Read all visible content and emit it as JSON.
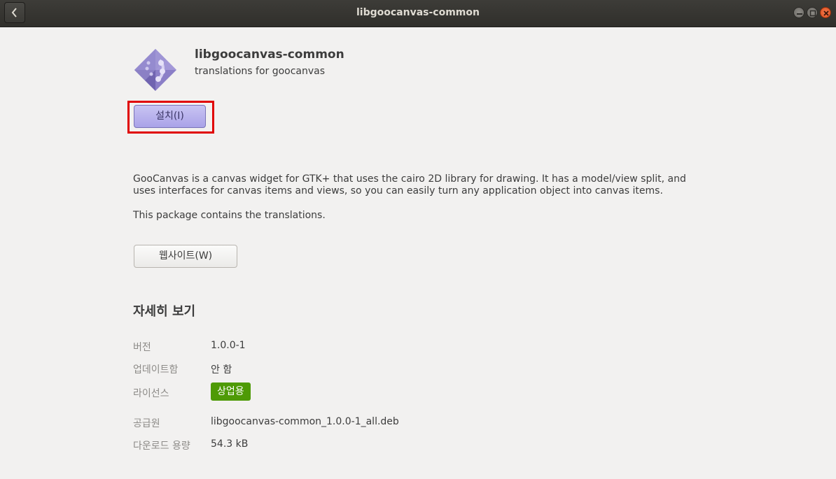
{
  "window": {
    "title": "libgoocanvas-common",
    "back_icon": "chevron-left-icon",
    "controls": [
      "minimize-icon",
      "maximize-icon",
      "close-icon"
    ],
    "close_color": "#e95420"
  },
  "app": {
    "name": "libgoocanvas-common",
    "summary": "translations for goocanvas",
    "icon": "package-icon",
    "icon_color": "#8b7fc7"
  },
  "actions": {
    "install_label": "설치(I)",
    "install_color": "#b3acec",
    "website_label": "웹사이트(W)"
  },
  "description": {
    "paragraphs": [
      "GooCanvas is a canvas widget for GTK+ that uses the cairo 2D library for drawing. It has a model/view split, and uses interfaces for canvas items and views, so you can easily turn any application object into canvas items.",
      "This package contains the translations."
    ]
  },
  "details": {
    "heading": "자세히 보기",
    "rows": [
      {
        "label": "버전",
        "value": "1.0.0-1"
      },
      {
        "label": "업데이트함",
        "value": "안 함"
      },
      {
        "label": "라이선스",
        "value": "상업용",
        "badge_color": "#4e9a06"
      },
      {
        "label": "공급원",
        "value": "libgoocanvas-common_1.0.0-1_all.deb"
      },
      {
        "label": "다운로드 용량",
        "value": "54.3 kB"
      }
    ]
  }
}
